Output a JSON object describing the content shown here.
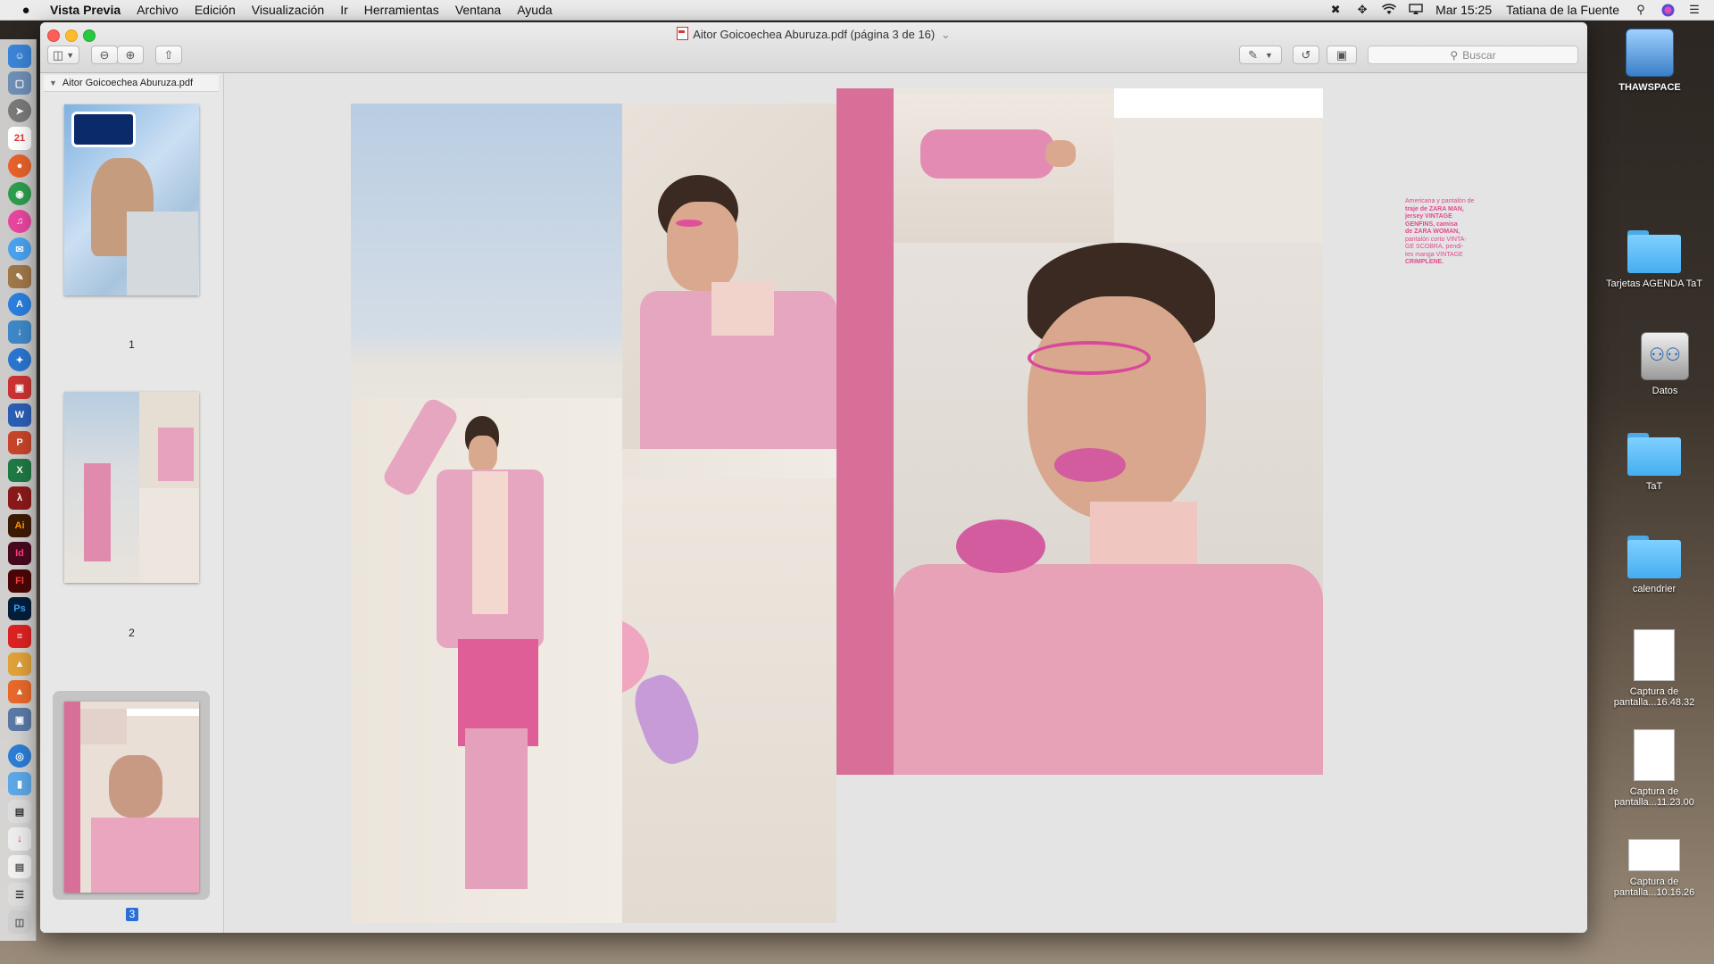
{
  "menubar": {
    "apple": "",
    "app_name": "Vista Previa",
    "menus": [
      "Archivo",
      "Edición",
      "Visualización",
      "Ir",
      "Herramientas",
      "Ventana",
      "Ayuda"
    ],
    "clock": "Mar 15:25",
    "user": "Tatiana de la Fuente"
  },
  "window": {
    "title": "Aitor Goicoechea Aburuza.pdf (página 3 de 16)",
    "title_chevron": "⌄",
    "search_placeholder": "Buscar"
  },
  "sidebar": {
    "document_name": "Aitor Goicoechea Aburuza.pdf",
    "pages": [
      {
        "number": "1"
      },
      {
        "number": "2"
      },
      {
        "number": "3",
        "selected": true
      }
    ]
  },
  "page_text": {
    "credits_lines": [
      "Americana y pantalón de",
      "traje de ZARA MAN,",
      "jersey VINTAGE",
      "GENFINS, camisa",
      "de ZARA WOMAN,",
      "pantalón corto VINTA-",
      "GE SCOBRA, pendi-",
      "tes manga VINTAGE",
      "CRIMPLENE."
    ]
  },
  "desktop": [
    {
      "name": "THAWSPACE",
      "kind": "disk"
    },
    {
      "name": "Tarjetas AGENDA TaT",
      "kind": "folder"
    },
    {
      "name": "Datos",
      "kind": "server"
    },
    {
      "name": "TaT",
      "kind": "folder"
    },
    {
      "name": "calendrier",
      "kind": "folder"
    },
    {
      "name": "Captura de pantalla...16.48.32",
      "kind": "file"
    },
    {
      "name": "Captura de pantalla...11.23.00",
      "kind": "file"
    },
    {
      "name": "Captura de pantalla...10.16.26",
      "kind": "file"
    }
  ],
  "colors": {
    "magenta_band": "#d86f98",
    "accent_blue": "#2a6fd6",
    "credits_pink": "#e14a8f"
  }
}
